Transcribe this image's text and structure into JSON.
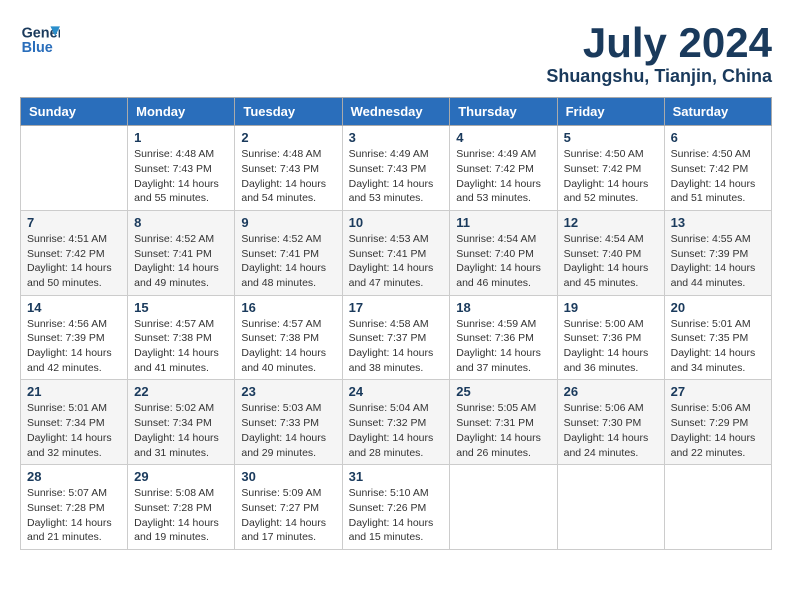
{
  "header": {
    "logo_line1": "General",
    "logo_line2": "Blue",
    "month": "July 2024",
    "location": "Shuangshu, Tianjin, China"
  },
  "days_of_week": [
    "Sunday",
    "Monday",
    "Tuesday",
    "Wednesday",
    "Thursday",
    "Friday",
    "Saturday"
  ],
  "weeks": [
    [
      {
        "day": "",
        "info": ""
      },
      {
        "day": "1",
        "info": "Sunrise: 4:48 AM\nSunset: 7:43 PM\nDaylight: 14 hours\nand 55 minutes."
      },
      {
        "day": "2",
        "info": "Sunrise: 4:48 AM\nSunset: 7:43 PM\nDaylight: 14 hours\nand 54 minutes."
      },
      {
        "day": "3",
        "info": "Sunrise: 4:49 AM\nSunset: 7:43 PM\nDaylight: 14 hours\nand 53 minutes."
      },
      {
        "day": "4",
        "info": "Sunrise: 4:49 AM\nSunset: 7:42 PM\nDaylight: 14 hours\nand 53 minutes."
      },
      {
        "day": "5",
        "info": "Sunrise: 4:50 AM\nSunset: 7:42 PM\nDaylight: 14 hours\nand 52 minutes."
      },
      {
        "day": "6",
        "info": "Sunrise: 4:50 AM\nSunset: 7:42 PM\nDaylight: 14 hours\nand 51 minutes."
      }
    ],
    [
      {
        "day": "7",
        "info": "Sunrise: 4:51 AM\nSunset: 7:42 PM\nDaylight: 14 hours\nand 50 minutes."
      },
      {
        "day": "8",
        "info": "Sunrise: 4:52 AM\nSunset: 7:41 PM\nDaylight: 14 hours\nand 49 minutes."
      },
      {
        "day": "9",
        "info": "Sunrise: 4:52 AM\nSunset: 7:41 PM\nDaylight: 14 hours\nand 48 minutes."
      },
      {
        "day": "10",
        "info": "Sunrise: 4:53 AM\nSunset: 7:41 PM\nDaylight: 14 hours\nand 47 minutes."
      },
      {
        "day": "11",
        "info": "Sunrise: 4:54 AM\nSunset: 7:40 PM\nDaylight: 14 hours\nand 46 minutes."
      },
      {
        "day": "12",
        "info": "Sunrise: 4:54 AM\nSunset: 7:40 PM\nDaylight: 14 hours\nand 45 minutes."
      },
      {
        "day": "13",
        "info": "Sunrise: 4:55 AM\nSunset: 7:39 PM\nDaylight: 14 hours\nand 44 minutes."
      }
    ],
    [
      {
        "day": "14",
        "info": "Sunrise: 4:56 AM\nSunset: 7:39 PM\nDaylight: 14 hours\nand 42 minutes."
      },
      {
        "day": "15",
        "info": "Sunrise: 4:57 AM\nSunset: 7:38 PM\nDaylight: 14 hours\nand 41 minutes."
      },
      {
        "day": "16",
        "info": "Sunrise: 4:57 AM\nSunset: 7:38 PM\nDaylight: 14 hours\nand 40 minutes."
      },
      {
        "day": "17",
        "info": "Sunrise: 4:58 AM\nSunset: 7:37 PM\nDaylight: 14 hours\nand 38 minutes."
      },
      {
        "day": "18",
        "info": "Sunrise: 4:59 AM\nSunset: 7:36 PM\nDaylight: 14 hours\nand 37 minutes."
      },
      {
        "day": "19",
        "info": "Sunrise: 5:00 AM\nSunset: 7:36 PM\nDaylight: 14 hours\nand 36 minutes."
      },
      {
        "day": "20",
        "info": "Sunrise: 5:01 AM\nSunset: 7:35 PM\nDaylight: 14 hours\nand 34 minutes."
      }
    ],
    [
      {
        "day": "21",
        "info": "Sunrise: 5:01 AM\nSunset: 7:34 PM\nDaylight: 14 hours\nand 32 minutes."
      },
      {
        "day": "22",
        "info": "Sunrise: 5:02 AM\nSunset: 7:34 PM\nDaylight: 14 hours\nand 31 minutes."
      },
      {
        "day": "23",
        "info": "Sunrise: 5:03 AM\nSunset: 7:33 PM\nDaylight: 14 hours\nand 29 minutes."
      },
      {
        "day": "24",
        "info": "Sunrise: 5:04 AM\nSunset: 7:32 PM\nDaylight: 14 hours\nand 28 minutes."
      },
      {
        "day": "25",
        "info": "Sunrise: 5:05 AM\nSunset: 7:31 PM\nDaylight: 14 hours\nand 26 minutes."
      },
      {
        "day": "26",
        "info": "Sunrise: 5:06 AM\nSunset: 7:30 PM\nDaylight: 14 hours\nand 24 minutes."
      },
      {
        "day": "27",
        "info": "Sunrise: 5:06 AM\nSunset: 7:29 PM\nDaylight: 14 hours\nand 22 minutes."
      }
    ],
    [
      {
        "day": "28",
        "info": "Sunrise: 5:07 AM\nSunset: 7:28 PM\nDaylight: 14 hours\nand 21 minutes."
      },
      {
        "day": "29",
        "info": "Sunrise: 5:08 AM\nSunset: 7:28 PM\nDaylight: 14 hours\nand 19 minutes."
      },
      {
        "day": "30",
        "info": "Sunrise: 5:09 AM\nSunset: 7:27 PM\nDaylight: 14 hours\nand 17 minutes."
      },
      {
        "day": "31",
        "info": "Sunrise: 5:10 AM\nSunset: 7:26 PM\nDaylight: 14 hours\nand 15 minutes."
      },
      {
        "day": "",
        "info": ""
      },
      {
        "day": "",
        "info": ""
      },
      {
        "day": "",
        "info": ""
      }
    ]
  ]
}
